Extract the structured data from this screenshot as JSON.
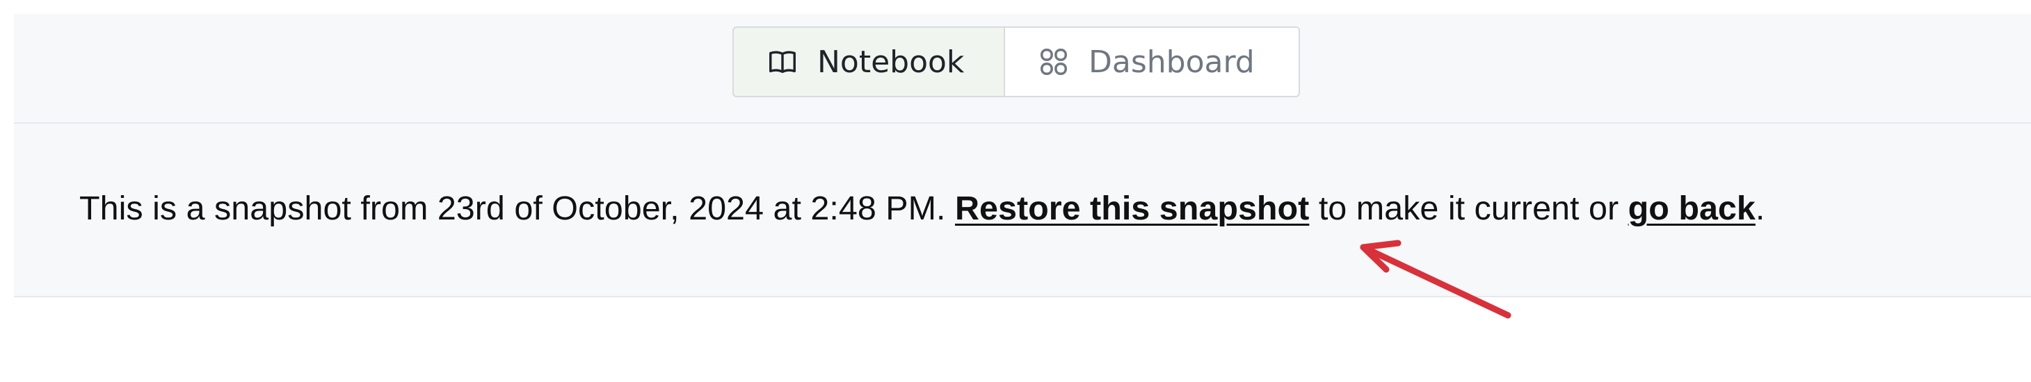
{
  "toolbar": {
    "tabs": [
      {
        "label": "Notebook",
        "icon": "book-icon",
        "active": true
      },
      {
        "label": "Dashboard",
        "icon": "grid-icon",
        "active": false
      }
    ]
  },
  "banner": {
    "prefix": "This is a snapshot from 23rd of October, 2024 at 2:48 PM.",
    "restore_link": "Restore this snapshot",
    "middle": "to make it current or",
    "back_link": "go back",
    "suffix": "."
  },
  "annotation": {
    "arrow_color": "#d8313a"
  }
}
